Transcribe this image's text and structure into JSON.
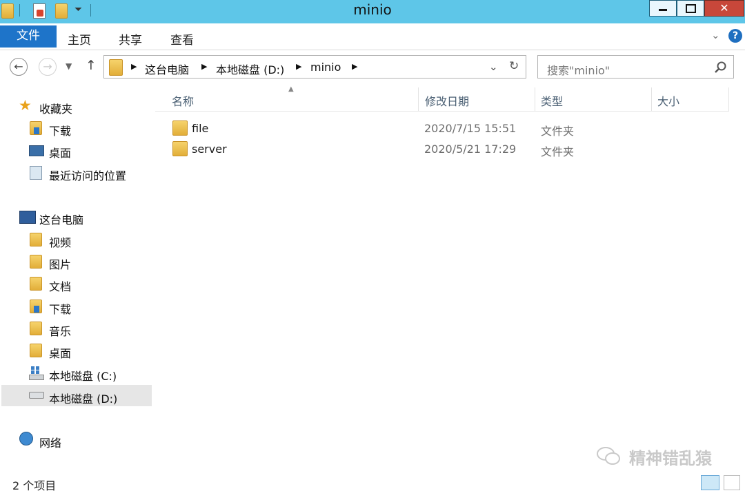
{
  "window": {
    "title": "minio"
  },
  "ribbon": {
    "file_tab": "文件",
    "tabs": [
      "主页",
      "共享",
      "查看"
    ]
  },
  "address": {
    "crumbs": [
      "这台电脑",
      "本地磁盘 (D:)",
      "minio"
    ],
    "search_placeholder": "搜索\"minio\""
  },
  "sidebar": {
    "favorites_header": "收藏夹",
    "favorites": [
      "下载",
      "桌面",
      "最近访问的位置"
    ],
    "pc_header": "这台电脑",
    "pc_items": [
      "视频",
      "图片",
      "文档",
      "下载",
      "音乐",
      "桌面",
      "本地磁盘 (C:)",
      "本地磁盘 (D:)"
    ],
    "network": "网络"
  },
  "columns": {
    "name": "名称",
    "modified": "修改日期",
    "type": "类型",
    "size": "大小"
  },
  "files": [
    {
      "name": "file",
      "modified": "2020/7/15 15:51",
      "type": "文件夹",
      "size": ""
    },
    {
      "name": "server",
      "modified": "2020/5/21 17:29",
      "type": "文件夹",
      "size": ""
    }
  ],
  "status": {
    "count": "2 个项目"
  },
  "watermark": "精神错乱猿",
  "colors": {
    "titlebar": "#5ec6e8",
    "file_tab": "#1e74c9",
    "selected_nav": "#e6e6e6"
  }
}
